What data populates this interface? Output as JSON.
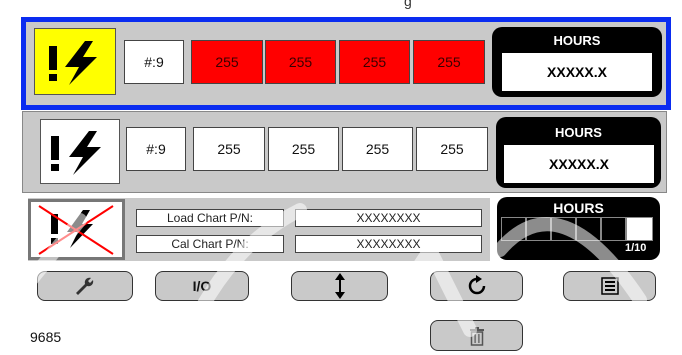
{
  "header": {
    "title_fragment": "g"
  },
  "row1": {
    "id_label": "#:9",
    "values": [
      "255",
      "255",
      "255",
      "255"
    ],
    "hours": {
      "label": "HOURS",
      "value": "XXXXX.X"
    },
    "colors": {
      "selected_border": "#0a2cf0",
      "alarm_bg": "#ffff00",
      "value_bg": "#ff0000"
    }
  },
  "row2": {
    "id_label": "#:9",
    "values": [
      "255",
      "255",
      "255",
      "255"
    ],
    "hours": {
      "label": "HOURS",
      "value": "XXXXX.X"
    }
  },
  "row3": {
    "load_chart_label": "Load Chart P/N:",
    "load_chart_value": "XXXXXXXX",
    "cal_chart_label": "Cal Chart P/N:",
    "cal_chart_value": "XXXXXXXX",
    "hours": {
      "label": "HOURS",
      "page": "1/10",
      "level_segments_filled": 1,
      "segments_total": 6
    }
  },
  "toolbar": {
    "wrench_icon": "wrench-icon",
    "io_label": "I/O",
    "updown_icon": "up-down-arrows-icon",
    "refresh_icon": "refresh-icon",
    "list_icon": "list-icon",
    "trash_icon": "trash-icon"
  },
  "footer": {
    "code": "9685"
  }
}
